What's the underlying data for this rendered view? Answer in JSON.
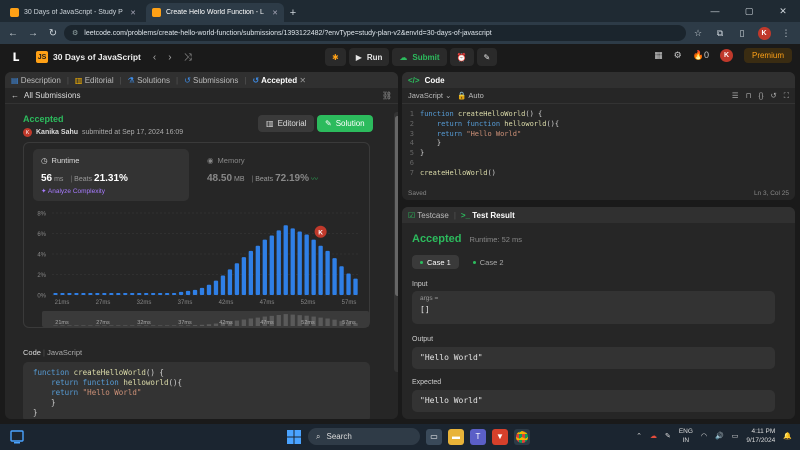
{
  "browser": {
    "tabs": [
      {
        "title": "30 Days of JavaScript - Study P",
        "active": false
      },
      {
        "title": "Create Hello World Function - L",
        "active": true
      }
    ],
    "url": "leetcode.com/problems/create-hello-world-function/submissions/1393122482/?envType=study-plan-v2&envId=30-days-of-javascript",
    "profile_initial": "K"
  },
  "nav": {
    "plan_title": "30 Days of JavaScript",
    "run_label": "Run",
    "submit_label": "Submit",
    "streak": "0",
    "avatar_initial": "K",
    "premium_label": "Premium"
  },
  "left": {
    "tabs": [
      "Description",
      "Editorial",
      "Solutions",
      "Submissions",
      "Accepted"
    ],
    "all_submissions": "All Submissions",
    "status": "Accepted",
    "author": "Kanika Sahu",
    "submitted_text": "submitted at Sep 17, 2024 16:09",
    "editorial_btn": "Editorial",
    "solution_btn": "Solution",
    "runtime": {
      "title": "Runtime",
      "value": "56",
      "unit": "ms",
      "beats_label": "Beats",
      "beats": "21.31%",
      "analyze": "Analyze Complexity"
    },
    "memory": {
      "title": "Memory",
      "value": "48.50",
      "unit": "MB",
      "beats_label": "Beats",
      "beats": "72.19%"
    },
    "code_label": "Code",
    "code_lang": "JavaScript",
    "code_lines": [
      "function createHelloWorld() {",
      "    return function helloworld(){",
      "    return \"Hello World\"",
      "    }",
      "}"
    ]
  },
  "chart_data": {
    "type": "bar",
    "y_ticks": [
      "8%",
      "6%",
      "4%",
      "2%",
      "0%"
    ],
    "ylim": [
      0,
      8
    ],
    "x_tick_labels": [
      "21ms",
      "27ms",
      "32ms",
      "37ms",
      "42ms",
      "47ms",
      "52ms",
      "57ms"
    ],
    "values": [
      0.2,
      0.2,
      0.2,
      0.2,
      0.2,
      0.2,
      0.2,
      0.2,
      0.2,
      0.2,
      0.2,
      0.2,
      0.2,
      0.2,
      0.2,
      0.2,
      0.2,
      0.2,
      0.3,
      0.4,
      0.5,
      0.7,
      1.0,
      1.4,
      1.9,
      2.5,
      3.1,
      3.7,
      4.3,
      4.8,
      5.4,
      5.8,
      6.3,
      6.8,
      6.5,
      6.2,
      5.9,
      5.4,
      4.8,
      4.3,
      3.6,
      2.8,
      2.1,
      1.6
    ],
    "highlight_index": 38,
    "highlight_label": "K"
  },
  "code_panel": {
    "title": "Code",
    "language": "JavaScript",
    "mode": "Auto",
    "lines": [
      "function createHelloWorld() {",
      "    return function helloworld(){",
      "    return \"Hello World\"",
      "    }",
      "}",
      "",
      "createHelloWorld()"
    ],
    "saved": "Saved",
    "cursor": "Ln 3, Col 25"
  },
  "test_panel": {
    "testcase_tab": "Testcase",
    "result_tab": "Test Result",
    "status": "Accepted",
    "runtime": "Runtime: 52 ms",
    "cases": [
      "Case 1",
      "Case 2"
    ],
    "input_label": "Input",
    "args_label": "args =",
    "args_value": "[]",
    "output_label": "Output",
    "output_value": "\"Hello World\"",
    "expected_label": "Expected",
    "expected_value": "\"Hello World\""
  },
  "taskbar": {
    "search_label": "Search",
    "lang_top": "ENG",
    "lang_bottom": "IN",
    "time": "4:11 PM",
    "date": "9/17/2024"
  }
}
